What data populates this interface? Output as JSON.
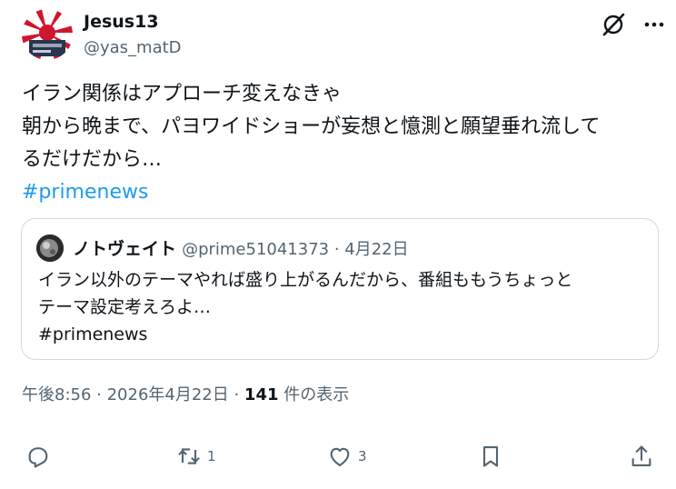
{
  "author": {
    "name": "Jesus13",
    "handle": "@yas_matD"
  },
  "tweet": {
    "lines": [
      "イラン関係はアプローチ変えなきゃ",
      "朝から晩まで、パヨワイドショーが妄想と憶測と願望垂れ流して",
      "るだけだから…"
    ],
    "hashtag": "#primenews"
  },
  "quote": {
    "name": "ノトヴェイト",
    "handle": "@prime51041373 · 4月22日",
    "lines": [
      "イラン以外のテーマやれば盛り上がるんだから、番組ももうちょっと",
      "テーマ設定考えろよ…",
      "#primenews"
    ]
  },
  "meta": {
    "time": "午後8:56 · 2026年4月22日 · ",
    "views_count": "141",
    "views_label": " 件の表示"
  },
  "actions": {
    "reply_icon": "reply-icon",
    "retweet_icon": "retweet-icon",
    "retweet_count": "1",
    "like_icon": "like-icon",
    "like_count": "3",
    "bookmark_icon": "bookmark-icon",
    "share_icon": "share-icon"
  },
  "colors": {
    "text": "#0f1419",
    "secondary": "#536471",
    "link": "#1d9bf0",
    "border": "#cfd9de"
  }
}
